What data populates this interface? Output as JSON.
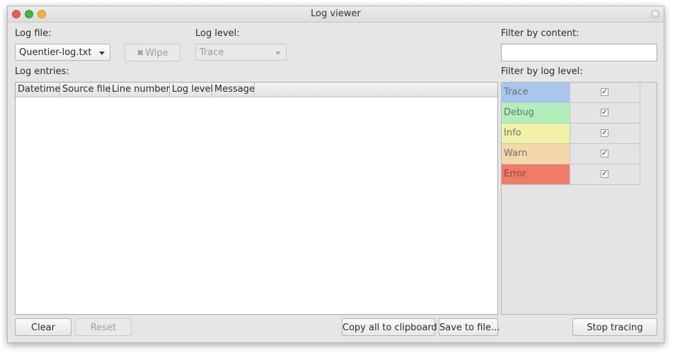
{
  "window": {
    "title": "Log viewer"
  },
  "log_file": {
    "label": "Log file:",
    "value": "Quentier-log.txt"
  },
  "wipe_button": {
    "icon": "✖",
    "label": "Wipe"
  },
  "log_level": {
    "label": "Log level:",
    "value": "Trace"
  },
  "filter_content": {
    "label": "Filter by content:",
    "value": ""
  },
  "entries": {
    "label": "Log entries:",
    "columns": [
      "Datetime",
      "Source file",
      "Line number",
      "Log level",
      "Message"
    ]
  },
  "filter_level": {
    "label": "Filter by log level:",
    "levels": [
      {
        "name": "Trace",
        "color": "#a9c6ee",
        "checked": true
      },
      {
        "name": "Debug",
        "color": "#b0efb9",
        "checked": true
      },
      {
        "name": "Info",
        "color": "#f2f2a6",
        "checked": true
      },
      {
        "name": "Warn",
        "color": "#f2d8ab",
        "checked": true
      },
      {
        "name": "Error",
        "color": "#ef7b69",
        "checked": true
      }
    ]
  },
  "buttons": {
    "clear": "Clear",
    "reset": "Reset",
    "copy_all": "Copy all to clipboard",
    "save_to_file": "Save to file...",
    "stop_tracing": "Stop tracing"
  }
}
